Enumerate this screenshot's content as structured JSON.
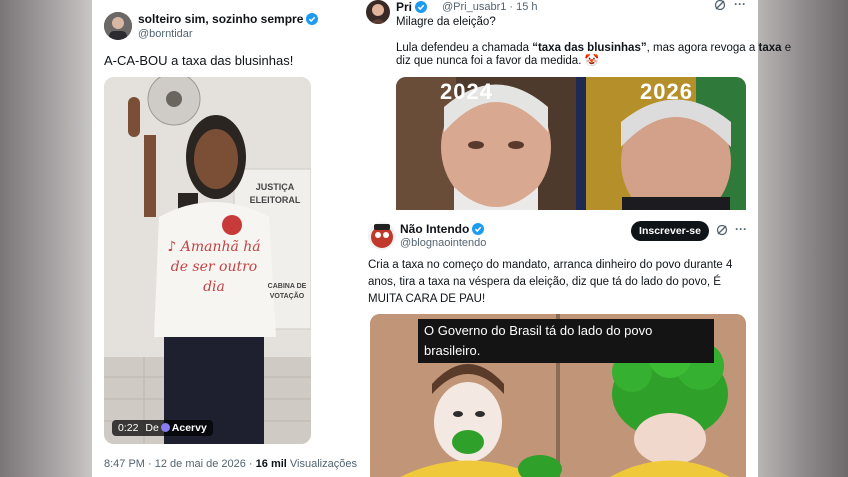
{
  "left_tweet": {
    "name": "solteiro sim, sozinho sempre",
    "handle": "@borntidar",
    "text": "A-CA-BOU a taxa das blusinhas!",
    "video_time": "0:22",
    "video_source_prefix": "De",
    "video_source": "Acervy",
    "shirt_text": "♪ Amanhã há de ser outro dia",
    "booth_sign": "JUSTIÇA ELEITORAL",
    "booth_sign2": "CABINA DE VOTAÇÃO",
    "timestamp": "8:47 PM · 12 de mai de 2026 ·",
    "views_count": "16 mil",
    "views_label": "Visualizações"
  },
  "top_tweet": {
    "name": "Pri",
    "handle": "@Pri_usabr1 · 15 h",
    "line1": "Milagre da eleição?",
    "p1": "Lula defendeu a chamada ",
    "bold1": "“taxa das blusinhas”",
    "p2": ", mas agora revoga a ",
    "bold2": "taxa",
    "p3": " e",
    "line3": "diz que nunca foi a favor da medida. 🤡",
    "img_left_year": "2024",
    "img_right_year": "2026"
  },
  "quote_tweet": {
    "name": "Não Intendo",
    "handle": "@blognaointendo",
    "subscribe_label": "Inscrever-se",
    "text": "Cria a taxa no começo do mandato, arranca dinheiro do povo durante 4 anos, tira a taxa na véspera da eleição, diz que tá do lado do povo, É MUITA CARA DE PAU!",
    "caption_line1": "O Governo do Brasil tá do lado do povo",
    "caption_line2": "brasileiro."
  },
  "colors": {
    "verified": "#1d9bf0",
    "text_secondary": "#536471",
    "clown_green": "#2fa12a"
  }
}
